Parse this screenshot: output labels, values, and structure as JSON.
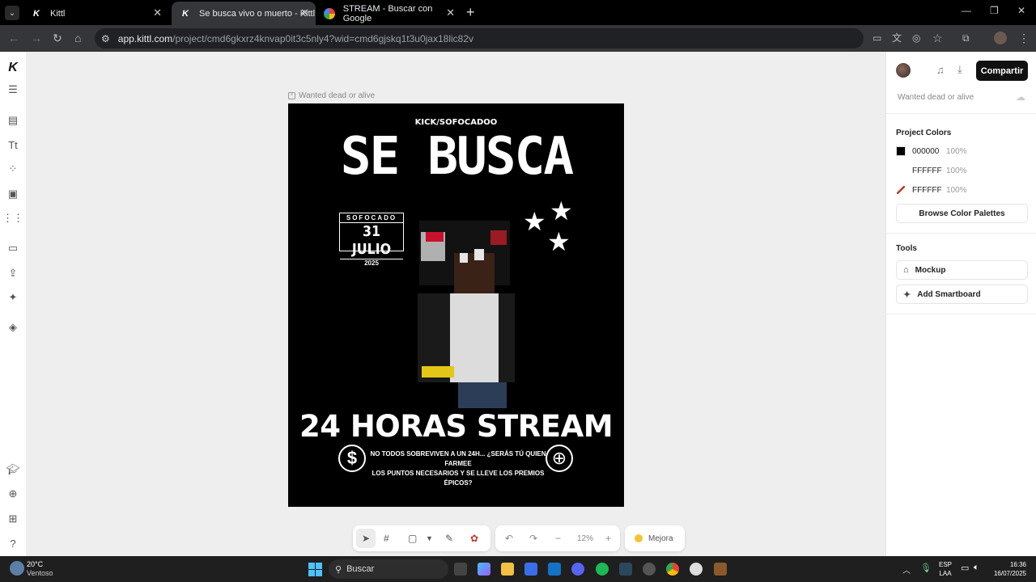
{
  "browser": {
    "tabs": [
      {
        "title": "Kittl",
        "active": false
      },
      {
        "title": "Se busca vivo o muerto - Kittl",
        "active": true
      },
      {
        "title": "STREAM - Buscar con Google",
        "active": false
      }
    ],
    "url_domain": "app.kittl.com",
    "url_path": "/project/cmd6gkxrz4knvap0it3c5nly4?wid=cmd6gjskq1t3u0jax18lic82v"
  },
  "canvas": {
    "artboard_label": "Wanted dead or alive"
  },
  "poster": {
    "top_text": "KICK/SOFOCADOO",
    "headline": "SE BUSCA",
    "date_top": "SOFOCADO",
    "date_main": "31 JULIO",
    "date_year": "2025",
    "title": "24 HORAS STREAM",
    "subtitle_line1": "NO TODOS SOBREVIVEN A UN 24H... ¿SERÁS TÚ QUIEN FARMEE",
    "subtitle_line2": "LOS PUNTOS NECESARIOS Y SE LLEVE LOS PREMIOS ÉPICOS?"
  },
  "bottom_toolbar": {
    "zoom": "12%",
    "improve_label": "Mejora"
  },
  "right_panel": {
    "share_label": "Compartir",
    "project_name": "Wanted dead or alive",
    "project_colors_title": "Project Colors",
    "colors": [
      {
        "hex": "000000",
        "opacity": "100%",
        "swatch": "#000000"
      },
      {
        "hex": "FFFFFF",
        "opacity": "100%",
        "swatch": "#FFFFFF"
      },
      {
        "hex": "FFFFFF",
        "opacity": "100%",
        "swatch": "#FFFFFF"
      }
    ],
    "browse_palettes": "Browse Color Palettes",
    "tools_title": "Tools",
    "tools": [
      "Mockup",
      "Add Smartboard"
    ]
  },
  "taskbar": {
    "weather_temp": "20°C",
    "weather_desc": "Ventoso",
    "search_label": "Buscar",
    "lang_top": "ESP",
    "lang_bottom": "LAA",
    "time": "16:36",
    "date": "16/07/2025"
  },
  "colors": {
    "accent_black": "#111111",
    "brand_kittl": "#111111"
  }
}
